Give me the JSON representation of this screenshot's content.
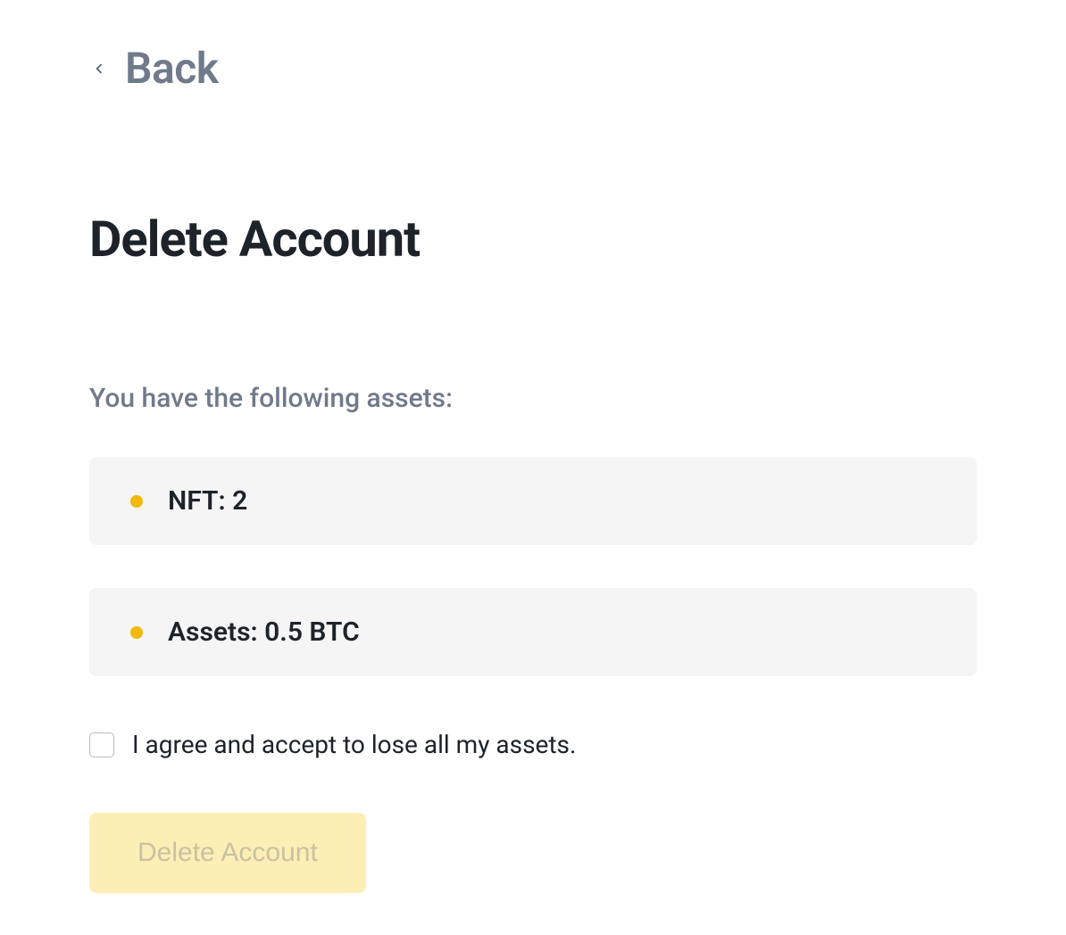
{
  "back": {
    "label": "Back"
  },
  "title": "Delete Account",
  "assets": {
    "label": "You have the following assets:",
    "items": [
      "NFT: 2",
      "Assets: 0.5 BTC"
    ]
  },
  "agreement": {
    "label": "I agree and accept to lose all my assets.",
    "checked": false
  },
  "delete_button": {
    "label": "Delete Account"
  },
  "colors": {
    "bullet": "#f0b90b",
    "button_bg": "#fcefb5",
    "button_text": "#c9c2a1"
  }
}
